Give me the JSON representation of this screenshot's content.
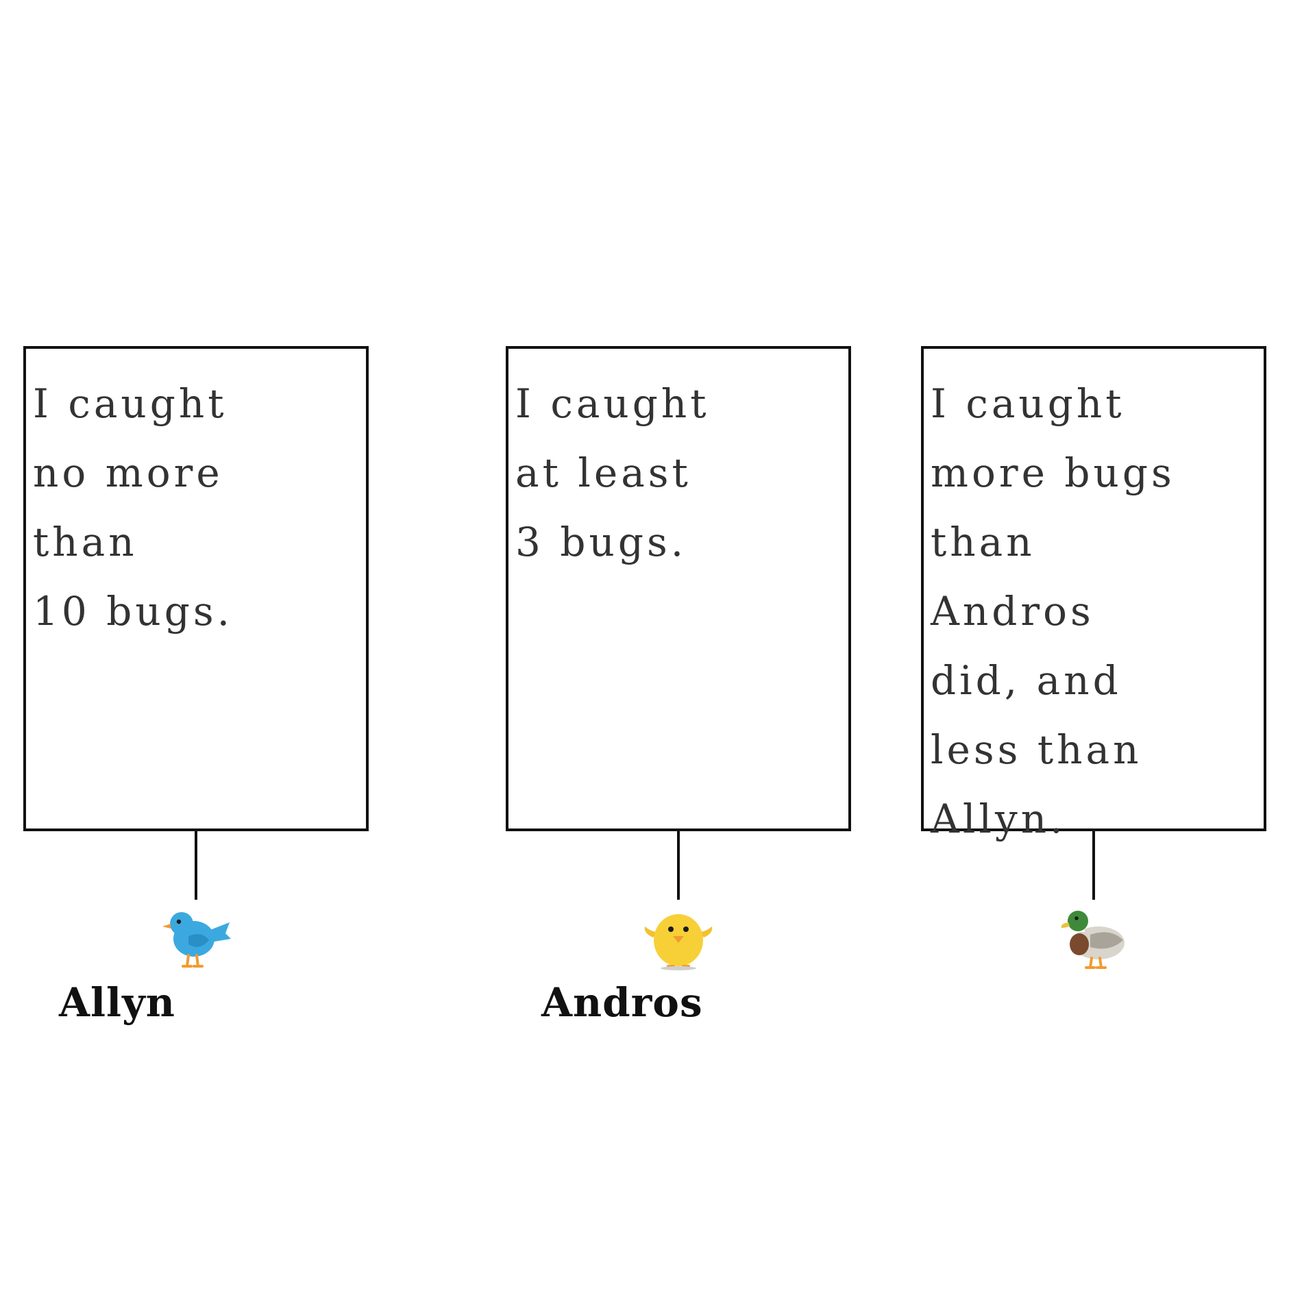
{
  "signs": [
    {
      "text": "I caught\nno more\nthan\n10 bugs.",
      "name": "Allyn",
      "bird_icon": "blue-bird-icon",
      "bird_color": "#3BA9E0"
    },
    {
      "text": "I caught\nat least\n3 bugs.",
      "name": "Andros",
      "bird_icon": "baby-chick-icon",
      "bird_color": "#F7D038"
    },
    {
      "text": "I caught\nmore bugs\nthan\nAndros\ndid, and\nless than\nAllyn.",
      "name": "",
      "bird_icon": "duck-icon",
      "bird_color": "#3E8A3A"
    }
  ],
  "colors": {
    "outline": "#111111",
    "sign_text": "#333333"
  }
}
